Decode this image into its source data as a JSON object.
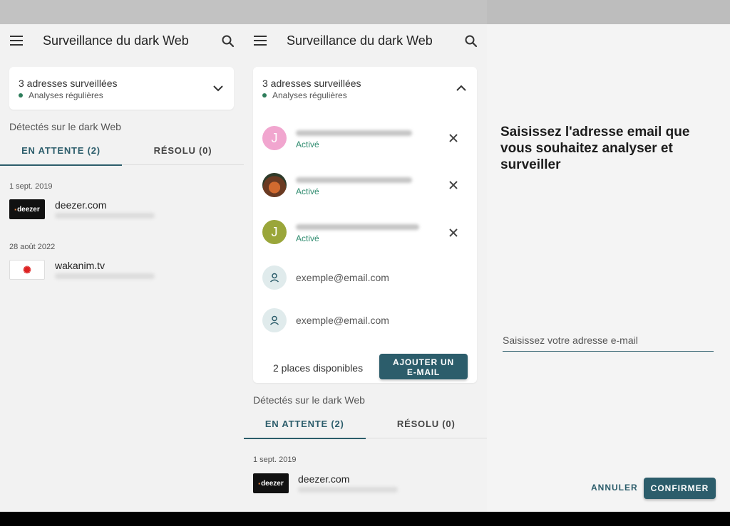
{
  "app": {
    "title": "Surveillance du dark Web"
  },
  "summary": {
    "title": "3 adresses surveillées",
    "subtitle": "Analyses régulières"
  },
  "section_label": "Détectés sur le dark Web",
  "tabs": [
    {
      "label": "EN ATTENTE (2)",
      "active": true
    },
    {
      "label": "RÉSOLU (0)",
      "active": false
    }
  ],
  "breaches": [
    {
      "date": "1 sept. 2019",
      "site": "deezer.com",
      "logo": "deezer"
    },
    {
      "date": "28 août 2022",
      "site": "wakanim.tv",
      "logo": "wakanim"
    }
  ],
  "monitored": [
    {
      "avatar_letter": "J",
      "status": "Activé"
    },
    {
      "avatar_letter": "",
      "status": "Activé"
    },
    {
      "avatar_letter": "J",
      "status": "Activé"
    }
  ],
  "empty_slots": [
    {
      "placeholder": "exemple@email.com"
    },
    {
      "placeholder": "exemple@email.com"
    }
  ],
  "places_label": "2 places disponibles",
  "add_button": {
    "line1": "AJOUTER UN",
    "line2": "E-MAIL"
  },
  "add_email": {
    "prompt": "Saisissez l'adresse email que vous souhaitez analyser et surveiller",
    "input_placeholder": "Saisissez votre adresse e-mail",
    "cancel_label": "ANNULER",
    "confirm_label": "CONFIRMER"
  },
  "colors": {
    "accent": "#2c5d6b",
    "active_green": "#2e8b6e",
    "status_dot": "#2e7d5b"
  },
  "icons": {
    "menu": "menu-icon",
    "search": "search-icon",
    "expand": "chevron-down-icon",
    "collapse": "chevron-up-icon",
    "remove": "close-icon",
    "person": "person-icon"
  }
}
